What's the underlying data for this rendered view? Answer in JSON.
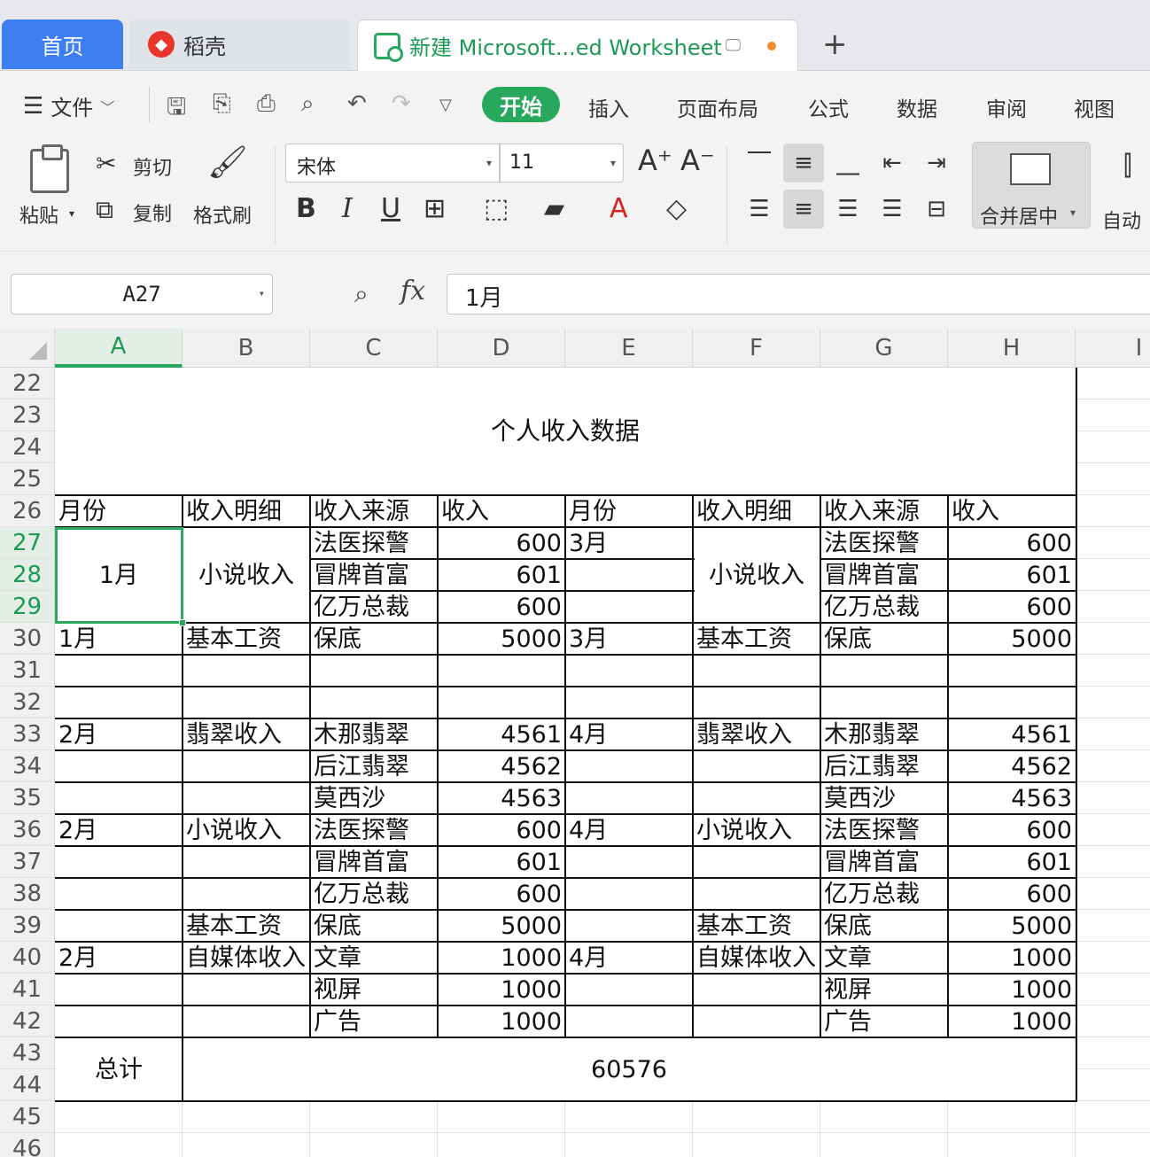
{
  "tabs": {
    "home": "首页",
    "daoke": "稻壳",
    "doc": "新建 Microsoft...ed Worksheet",
    "add": "+"
  },
  "toolbar": {
    "file": "文件",
    "ribbon_tabs": [
      "开始",
      "插入",
      "页面布局",
      "公式",
      "数据",
      "审阅",
      "视图"
    ]
  },
  "ribbon": {
    "paste": "粘贴",
    "cut": "剪切",
    "copy": "复制",
    "format_painter": "格式刷",
    "font_name": "宋体",
    "font_size": "11",
    "merge_center": "合并居中",
    "auto_wrap": "自动"
  },
  "formula_bar": {
    "cell_ref": "A27",
    "fx": "fx",
    "value": "1月"
  },
  "columns": [
    "A",
    "B",
    "C",
    "D",
    "E",
    "F",
    "G",
    "H",
    "I"
  ],
  "rows": [
    "22",
    "23",
    "24",
    "25",
    "26",
    "27",
    "28",
    "29",
    "30",
    "31",
    "32",
    "33",
    "34",
    "35",
    "36",
    "37",
    "38",
    "39",
    "40",
    "41",
    "42",
    "43",
    "44",
    "45",
    "46"
  ],
  "sheet": {
    "title": "个人收入数据",
    "headers": [
      "月份",
      "收入明细",
      "收入来源",
      "收入",
      "月份",
      "收入明细",
      "收入来源",
      "收入"
    ],
    "merged_month_a": "1月",
    "merged_detail_b": "小说收入",
    "merged_detail_f": "小说收入",
    "total_label": "总计",
    "total_value": "60576",
    "cells": [
      {
        "r": 27,
        "c": "C",
        "v": "法医探警"
      },
      {
        "r": 27,
        "c": "D",
        "v": "600"
      },
      {
        "r": 27,
        "c": "E",
        "v": "3月"
      },
      {
        "r": 27,
        "c": "G",
        "v": "法医探警"
      },
      {
        "r": 27,
        "c": "H",
        "v": "600"
      },
      {
        "r": 28,
        "c": "C",
        "v": "冒牌首富"
      },
      {
        "r": 28,
        "c": "D",
        "v": "601"
      },
      {
        "r": 28,
        "c": "G",
        "v": "冒牌首富"
      },
      {
        "r": 28,
        "c": "H",
        "v": "601"
      },
      {
        "r": 29,
        "c": "C",
        "v": "亿万总裁"
      },
      {
        "r": 29,
        "c": "D",
        "v": "600"
      },
      {
        "r": 29,
        "c": "G",
        "v": "亿万总裁"
      },
      {
        "r": 29,
        "c": "H",
        "v": "600"
      },
      {
        "r": 30,
        "c": "A",
        "v": "1月"
      },
      {
        "r": 30,
        "c": "B",
        "v": "基本工资"
      },
      {
        "r": 30,
        "c": "C",
        "v": "保底"
      },
      {
        "r": 30,
        "c": "D",
        "v": "5000"
      },
      {
        "r": 30,
        "c": "E",
        "v": "3月"
      },
      {
        "r": 30,
        "c": "F",
        "v": "基本工资"
      },
      {
        "r": 30,
        "c": "G",
        "v": "保底"
      },
      {
        "r": 30,
        "c": "H",
        "v": "5000"
      },
      {
        "r": 33,
        "c": "A",
        "v": "2月"
      },
      {
        "r": 33,
        "c": "B",
        "v": "翡翠收入"
      },
      {
        "r": 33,
        "c": "C",
        "v": "木那翡翠"
      },
      {
        "r": 33,
        "c": "D",
        "v": "4561"
      },
      {
        "r": 33,
        "c": "E",
        "v": "4月"
      },
      {
        "r": 33,
        "c": "F",
        "v": "翡翠收入"
      },
      {
        "r": 33,
        "c": "G",
        "v": "木那翡翠"
      },
      {
        "r": 33,
        "c": "H",
        "v": "4561"
      },
      {
        "r": 34,
        "c": "C",
        "v": "后江翡翠"
      },
      {
        "r": 34,
        "c": "D",
        "v": "4562"
      },
      {
        "r": 34,
        "c": "G",
        "v": "后江翡翠"
      },
      {
        "r": 34,
        "c": "H",
        "v": "4562"
      },
      {
        "r": 35,
        "c": "C",
        "v": "莫西沙"
      },
      {
        "r": 35,
        "c": "D",
        "v": "4563"
      },
      {
        "r": 35,
        "c": "G",
        "v": "莫西沙"
      },
      {
        "r": 35,
        "c": "H",
        "v": "4563"
      },
      {
        "r": 36,
        "c": "A",
        "v": "2月"
      },
      {
        "r": 36,
        "c": "B",
        "v": "小说收入"
      },
      {
        "r": 36,
        "c": "C",
        "v": "法医探警"
      },
      {
        "r": 36,
        "c": "D",
        "v": "600"
      },
      {
        "r": 36,
        "c": "E",
        "v": "4月"
      },
      {
        "r": 36,
        "c": "F",
        "v": "小说收入"
      },
      {
        "r": 36,
        "c": "G",
        "v": "法医探警"
      },
      {
        "r": 36,
        "c": "H",
        "v": "600"
      },
      {
        "r": 37,
        "c": "C",
        "v": "冒牌首富"
      },
      {
        "r": 37,
        "c": "D",
        "v": "601"
      },
      {
        "r": 37,
        "c": "G",
        "v": "冒牌首富"
      },
      {
        "r": 37,
        "c": "H",
        "v": "601"
      },
      {
        "r": 38,
        "c": "C",
        "v": "亿万总裁"
      },
      {
        "r": 38,
        "c": "D",
        "v": "600"
      },
      {
        "r": 38,
        "c": "G",
        "v": "亿万总裁"
      },
      {
        "r": 38,
        "c": "H",
        "v": "600"
      },
      {
        "r": 39,
        "c": "B",
        "v": "基本工资"
      },
      {
        "r": 39,
        "c": "C",
        "v": "保底"
      },
      {
        "r": 39,
        "c": "D",
        "v": "5000"
      },
      {
        "r": 39,
        "c": "F",
        "v": "基本工资"
      },
      {
        "r": 39,
        "c": "G",
        "v": "保底"
      },
      {
        "r": 39,
        "c": "H",
        "v": "5000"
      },
      {
        "r": 40,
        "c": "A",
        "v": "2月"
      },
      {
        "r": 40,
        "c": "B",
        "v": "自媒体收入"
      },
      {
        "r": 40,
        "c": "C",
        "v": "文章"
      },
      {
        "r": 40,
        "c": "D",
        "v": "1000"
      },
      {
        "r": 40,
        "c": "E",
        "v": "4月"
      },
      {
        "r": 40,
        "c": "F",
        "v": "自媒体收入"
      },
      {
        "r": 40,
        "c": "G",
        "v": "文章"
      },
      {
        "r": 40,
        "c": "H",
        "v": "1000"
      },
      {
        "r": 41,
        "c": "C",
        "v": "视屏"
      },
      {
        "r": 41,
        "c": "D",
        "v": "1000"
      },
      {
        "r": 41,
        "c": "G",
        "v": "视屏"
      },
      {
        "r": 41,
        "c": "H",
        "v": "1000"
      },
      {
        "r": 42,
        "c": "C",
        "v": "广告"
      },
      {
        "r": 42,
        "c": "D",
        "v": "1000"
      },
      {
        "r": 42,
        "c": "G",
        "v": "广告"
      },
      {
        "r": 42,
        "c": "H",
        "v": "1000"
      }
    ]
  },
  "colors": {
    "accent_green": "#27a85c",
    "home_tab_blue": "#3d7ff0",
    "daoke_red": "#e8342a",
    "unsaved_dot": "#f08a2a"
  }
}
